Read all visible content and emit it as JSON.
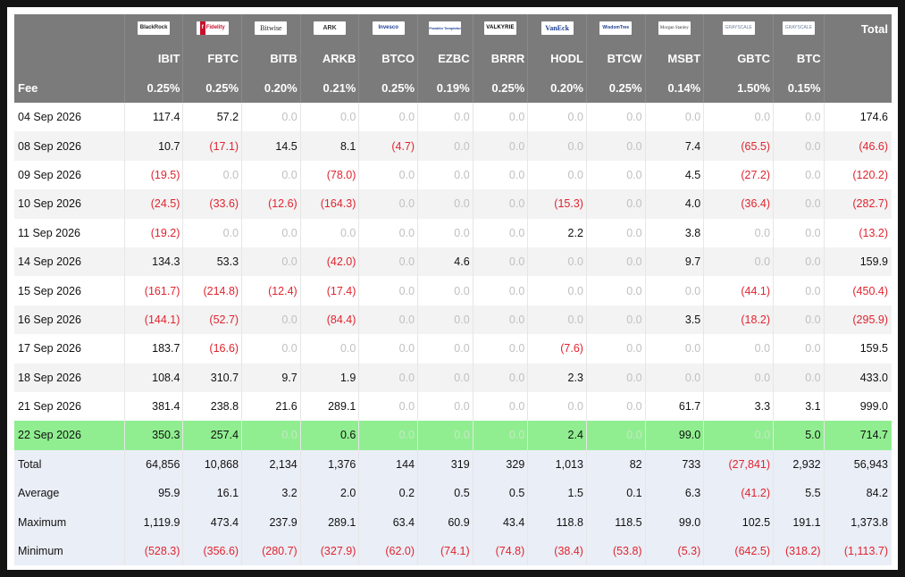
{
  "chart_data": {
    "type": "table",
    "logos": [
      "BlackRock",
      "Fidelity",
      "Bitwise",
      "ARK",
      "Invesco",
      "Franklin Templeton",
      "VALKYRIE",
      "VanEck",
      "WisdomTree",
      "Morgan Stanley",
      "GRAYSCALE",
      "GRAYSCALE"
    ],
    "total_label": "Total",
    "tickers": [
      "IBIT",
      "FBTC",
      "BITB",
      "ARKB",
      "BTCO",
      "EZBC",
      "BRRR",
      "HODL",
      "BTCW",
      "MSBT",
      "GBTC",
      "BTC"
    ],
    "fee_label": "Fee",
    "fees": [
      "0.25%",
      "0.25%",
      "0.20%",
      "0.21%",
      "0.25%",
      "0.19%",
      "0.25%",
      "0.20%",
      "0.25%",
      "0.14%",
      "1.50%",
      "0.15%"
    ],
    "rows": [
      {
        "date": "04 Sep 2026",
        "values": [
          "117.4",
          "57.2",
          "0.0",
          "0.0",
          "0.0",
          "0.0",
          "0.0",
          "0.0",
          "0.0",
          "0.0",
          "0.0",
          "0.0"
        ],
        "total": "174.6"
      },
      {
        "date": "08 Sep 2026",
        "values": [
          "10.7",
          "(17.1)",
          "14.5",
          "8.1",
          "(4.7)",
          "0.0",
          "0.0",
          "0.0",
          "0.0",
          "7.4",
          "(65.5)",
          "0.0"
        ],
        "total": "(46.6)"
      },
      {
        "date": "09 Sep 2026",
        "values": [
          "(19.5)",
          "0.0",
          "0.0",
          "(78.0)",
          "0.0",
          "0.0",
          "0.0",
          "0.0",
          "0.0",
          "4.5",
          "(27.2)",
          "0.0"
        ],
        "total": "(120.2)"
      },
      {
        "date": "10 Sep 2026",
        "values": [
          "(24.5)",
          "(33.6)",
          "(12.6)",
          "(164.3)",
          "0.0",
          "0.0",
          "0.0",
          "(15.3)",
          "0.0",
          "4.0",
          "(36.4)",
          "0.0"
        ],
        "total": "(282.7)"
      },
      {
        "date": "11 Sep 2026",
        "values": [
          "(19.2)",
          "0.0",
          "0.0",
          "0.0",
          "0.0",
          "0.0",
          "0.0",
          "2.2",
          "0.0",
          "3.8",
          "0.0",
          "0.0"
        ],
        "total": "(13.2)"
      },
      {
        "date": "14 Sep 2026",
        "values": [
          "134.3",
          "53.3",
          "0.0",
          "(42.0)",
          "0.0",
          "4.6",
          "0.0",
          "0.0",
          "0.0",
          "9.7",
          "0.0",
          "0.0"
        ],
        "total": "159.9"
      },
      {
        "date": "15 Sep 2026",
        "values": [
          "(161.7)",
          "(214.8)",
          "(12.4)",
          "(17.4)",
          "0.0",
          "0.0",
          "0.0",
          "0.0",
          "0.0",
          "0.0",
          "(44.1)",
          "0.0"
        ],
        "total": "(450.4)"
      },
      {
        "date": "16 Sep 2026",
        "values": [
          "(144.1)",
          "(52.7)",
          "0.0",
          "(84.4)",
          "0.0",
          "0.0",
          "0.0",
          "0.0",
          "0.0",
          "3.5",
          "(18.2)",
          "0.0"
        ],
        "total": "(295.9)"
      },
      {
        "date": "17 Sep 2026",
        "values": [
          "183.7",
          "(16.6)",
          "0.0",
          "0.0",
          "0.0",
          "0.0",
          "0.0",
          "(7.6)",
          "0.0",
          "0.0",
          "0.0",
          "0.0"
        ],
        "total": "159.5"
      },
      {
        "date": "18 Sep 2026",
        "values": [
          "108.4",
          "310.7",
          "9.7",
          "1.9",
          "0.0",
          "0.0",
          "0.0",
          "2.3",
          "0.0",
          "0.0",
          "0.0",
          "0.0"
        ],
        "total": "433.0"
      },
      {
        "date": "21 Sep 2026",
        "values": [
          "381.4",
          "238.8",
          "21.6",
          "289.1",
          "0.0",
          "0.0",
          "0.0",
          "0.0",
          "0.0",
          "61.7",
          "3.3",
          "3.1"
        ],
        "total": "999.0"
      },
      {
        "date": "22 Sep 2026",
        "values": [
          "350.3",
          "257.4",
          "0.0",
          "0.6",
          "0.0",
          "0.0",
          "0.0",
          "2.4",
          "0.0",
          "99.0",
          "0.0",
          "5.0"
        ],
        "total": "714.7",
        "highlight": true
      }
    ],
    "summary": [
      {
        "label": "Total",
        "values": [
          "64,856",
          "10,868",
          "2,134",
          "1,376",
          "144",
          "319",
          "329",
          "1,013",
          "82",
          "733",
          "(27,841)",
          "2,932"
        ],
        "total": "56,943"
      },
      {
        "label": "Average",
        "values": [
          "95.9",
          "16.1",
          "3.2",
          "2.0",
          "0.2",
          "0.5",
          "0.5",
          "1.5",
          "0.1",
          "6.3",
          "(41.2)",
          "5.5"
        ],
        "total": "84.2"
      },
      {
        "label": "Maximum",
        "values": [
          "1,119.9",
          "473.4",
          "237.9",
          "289.1",
          "63.4",
          "60.9",
          "43.4",
          "118.8",
          "118.5",
          "99.0",
          "102.5",
          "191.1"
        ],
        "total": "1,373.8"
      },
      {
        "label": "Minimum",
        "values": [
          "(528.3)",
          "(356.6)",
          "(280.7)",
          "(327.9)",
          "(62.0)",
          "(74.1)",
          "(74.8)",
          "(38.4)",
          "(53.8)",
          "(5.3)",
          "(642.5)",
          "(318.2)"
        ],
        "total": "(1,113.7)"
      }
    ],
    "colors": {
      "header_bg": "#7b7b7b",
      "negative": "#e0242f",
      "zero": "#c0c0c0",
      "highlight": "#90ee90",
      "summary_bg": "#eaeef6"
    }
  }
}
